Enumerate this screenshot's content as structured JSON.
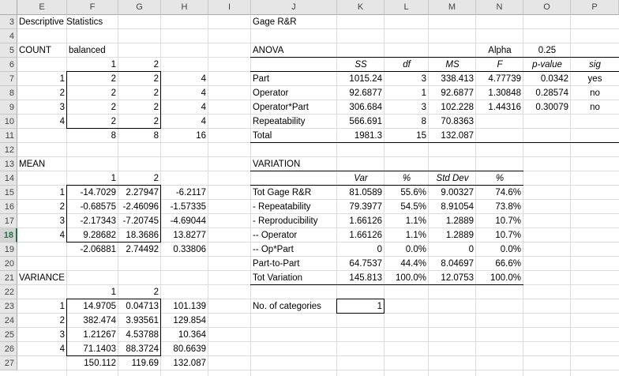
{
  "columns": [
    "E",
    "F",
    "G",
    "H",
    "I",
    "J",
    "K",
    "L",
    "M",
    "N",
    "O",
    "P"
  ],
  "rows": [
    "3",
    "4",
    "5",
    "6",
    "7",
    "8",
    "9",
    "10",
    "11",
    "12",
    "13",
    "14",
    "15",
    "16",
    "17",
    "18",
    "19",
    "20",
    "21",
    "22",
    "23",
    "24",
    "25",
    "26",
    "27"
  ],
  "selected_row": "18",
  "descriptive": {
    "title": "Descriptive Statistics",
    "count_label": "COUNT",
    "balanced_label": "balanced",
    "count_headers": [
      "1",
      "2"
    ],
    "count_rows": [
      [
        "1",
        "2",
        "2",
        "4"
      ],
      [
        "2",
        "2",
        "2",
        "4"
      ],
      [
        "3",
        "2",
        "2",
        "4"
      ],
      [
        "4",
        "2",
        "2",
        "4"
      ]
    ],
    "count_totals": [
      "8",
      "8",
      "16"
    ],
    "mean_label": "MEAN",
    "mean_headers": [
      "1",
      "2"
    ],
    "mean_rows": [
      [
        "1",
        "-14.7029",
        "2.27947",
        "-6.2117"
      ],
      [
        "2",
        "-0.68575",
        "-2.46096",
        "-1.57335"
      ],
      [
        "3",
        "-2.17343",
        "-7.20745",
        "-4.69044"
      ],
      [
        "4",
        "9.28682",
        "18.3686",
        "13.8277"
      ]
    ],
    "mean_totals": [
      "-2.06881",
      "2.74492",
      "0.33806"
    ],
    "variance_label": "VARIANCE",
    "variance_headers": [
      "1",
      "2"
    ],
    "variance_rows": [
      [
        "1",
        "14.9705",
        "0.04713",
        "101.139"
      ],
      [
        "2",
        "382.474",
        "3.93561",
        "129.854"
      ],
      [
        "3",
        "1.21267",
        "4.53788",
        "10.364"
      ],
      [
        "4",
        "71.1403",
        "88.3724",
        "80.6639"
      ]
    ],
    "variance_totals": [
      "150.112",
      "119.69",
      "132.087"
    ]
  },
  "gage": {
    "title": "Gage R&R",
    "anova_label": "ANOVA",
    "alpha_label": "Alpha",
    "alpha_value": "0.25",
    "anova_headers": [
      "SS",
      "df",
      "MS",
      "F",
      "p-value",
      "sig"
    ],
    "anova_rows": [
      [
        "Part",
        "1015.24",
        "3",
        "338.413",
        "4.77739",
        "0.0342",
        "yes"
      ],
      [
        "Operator",
        "92.6877",
        "1",
        "92.6877",
        "1.30848",
        "0.28574",
        "no"
      ],
      [
        "Operator*Part",
        "306.684",
        "3",
        "102.228",
        "1.44316",
        "0.30079",
        "no"
      ],
      [
        "Repeatability",
        "566.691",
        "8",
        "70.8363",
        "",
        "",
        ""
      ],
      [
        "Total",
        "1981.3",
        "15",
        "132.087",
        "",
        "",
        ""
      ]
    ],
    "variation_label": "VARIATION",
    "variation_headers": [
      "Var",
      "%",
      "Std Dev",
      "%"
    ],
    "variation_rows": [
      [
        "Tot Gage R&R",
        "81.0589",
        "55.6%",
        "9.00327",
        "74.6%"
      ],
      [
        "- Repeatability",
        "79.3977",
        "54.5%",
        "8.91054",
        "73.8%"
      ],
      [
        "- Reproducibility",
        "1.66126",
        "1.1%",
        "1.2889",
        "10.7%"
      ],
      [
        "-- Operator",
        "1.66126",
        "1.1%",
        "1.2889",
        "10.7%"
      ],
      [
        "-- Op*Part",
        "0",
        "0.0%",
        "0",
        "0.0%"
      ],
      [
        "Part-to-Part",
        "64.7537",
        "44.4%",
        "8.04697",
        "66.6%"
      ],
      [
        "Tot Variation",
        "145.813",
        "100.0%",
        "12.0753",
        "100.0%"
      ]
    ],
    "categories_label": "No. of categories",
    "categories_value": "1"
  }
}
